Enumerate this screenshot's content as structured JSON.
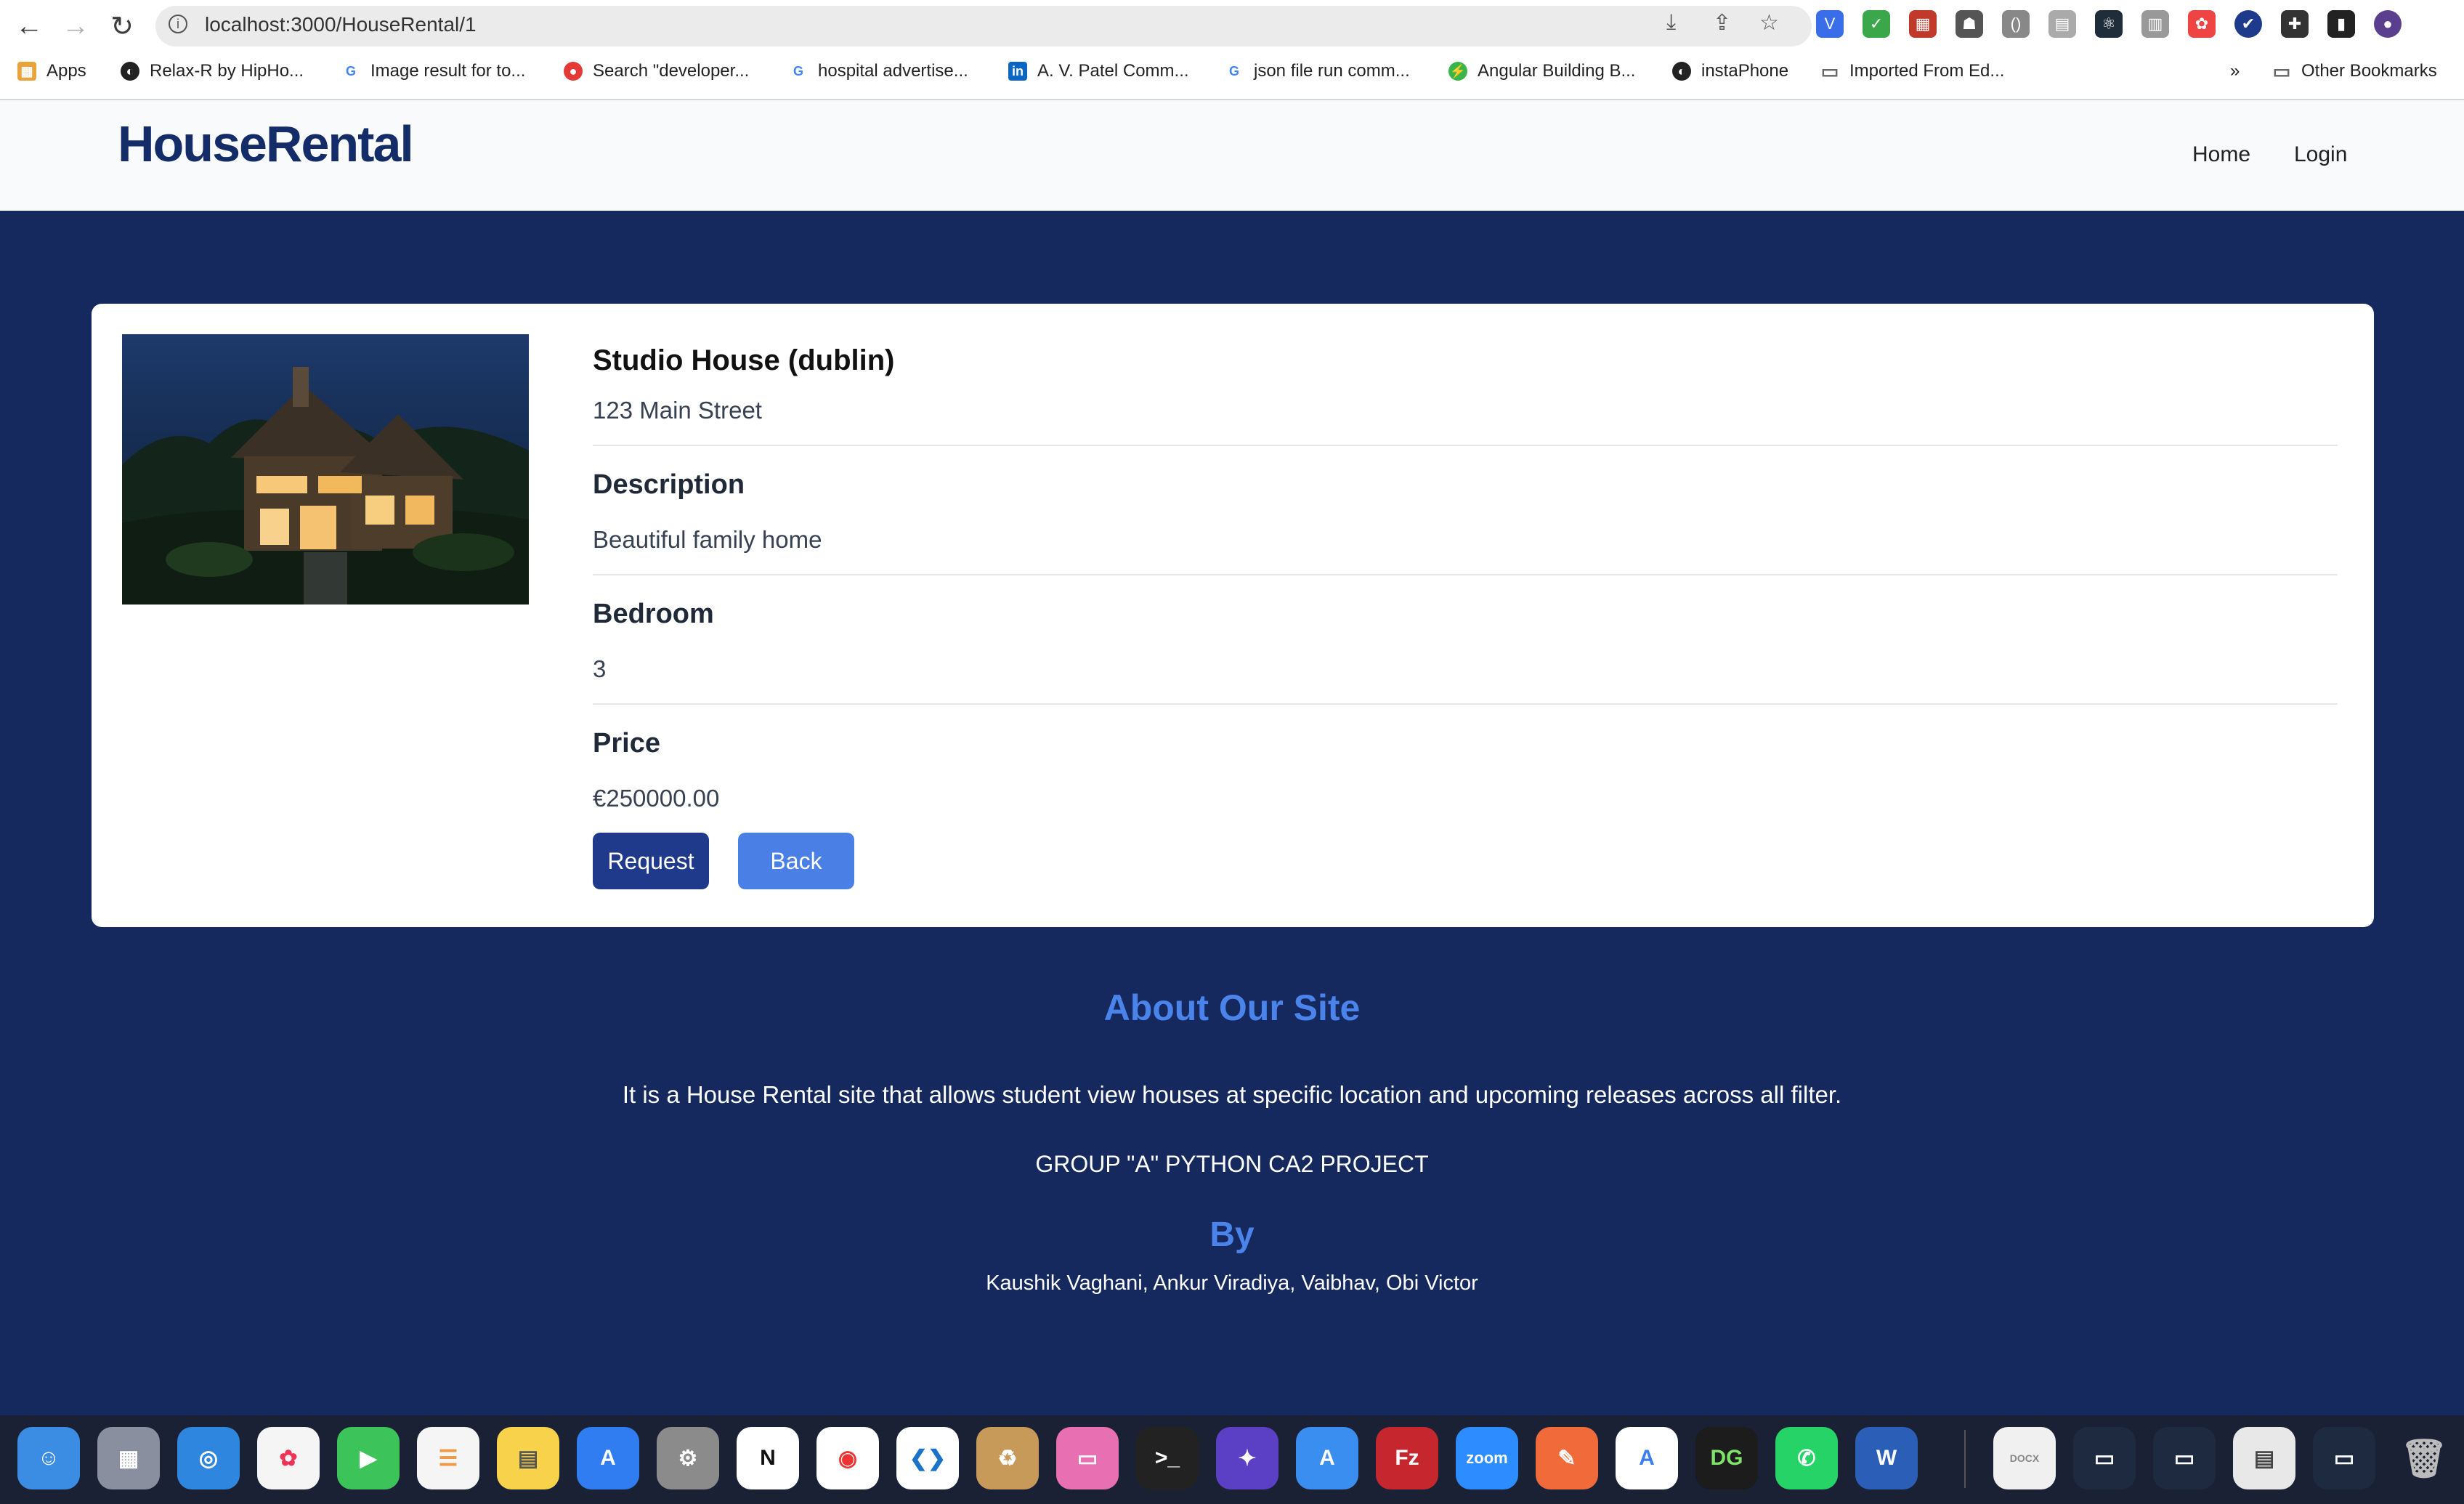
{
  "browser": {
    "url": "localhost:3000/HouseRental/1",
    "nav": {
      "back": "←",
      "forward": "→",
      "reload": "↻"
    },
    "bookmarks": [
      {
        "label": "Apps",
        "icon": "apps-grid-icon"
      },
      {
        "label": "Relax-R  by HipHo...",
        "icon": "globe-icon"
      },
      {
        "label": "Image result for to...",
        "icon": "google-icon"
      },
      {
        "label": "Search \"developer...",
        "icon": "red-circle-icon"
      },
      {
        "label": "hospital advertise...",
        "icon": "google-icon"
      },
      {
        "label": "A. V. Patel Comm...",
        "icon": "linkedin-icon"
      },
      {
        "label": "json file run comm...",
        "icon": "google-icon"
      },
      {
        "label": "Angular Building B...",
        "icon": "green-bolt-icon"
      },
      {
        "label": "instaPhone",
        "icon": "globe-icon"
      },
      {
        "label": "Imported From Ed...",
        "icon": "folder-icon"
      },
      {
        "label": "»",
        "icon": ""
      },
      {
        "label": "Other Bookmarks",
        "icon": "folder-icon"
      }
    ]
  },
  "header": {
    "brand": "HouseRental",
    "nav": [
      {
        "label": "Home"
      },
      {
        "label": "Login"
      }
    ]
  },
  "property": {
    "title": "Studio House (dublin)",
    "address": "123 Main Street",
    "description_label": "Description",
    "description": "Beautiful family home",
    "bedroom_label": "Bedroom",
    "bedroom": "3",
    "price_label": "Price",
    "price": "€250000.00",
    "request_label": "Request",
    "back_label": "Back"
  },
  "about": {
    "heading": "About Our Site",
    "text": "It is a House Rental site that allows student view houses at specific location and upcoming releases across all filter.",
    "project": "GROUP \"A\" PYTHON CA2 PROJECT",
    "by_heading": "By",
    "authors": "Kaushik Vaghani, Ankur Viradiya, Vaibhav, Obi Victor"
  },
  "colors": {
    "page_bg": "#15295e",
    "brand": "#142c67",
    "request_button": "#1f3a8a",
    "back_button": "#4a7fe6",
    "accent_heading": "#4a84ea"
  },
  "dock": [
    "Finder",
    "Launchpad",
    "Safari",
    "Photos",
    "FaceTime",
    "Reminders",
    "Notes",
    "App Store",
    "System Preferences",
    "Notion",
    "Chrome",
    "VS Code",
    "Archive Utility",
    "Screens",
    "Terminal",
    "Siri",
    "Xcode",
    "FileZilla",
    "zoom",
    "Pen",
    "Instruments",
    "DataGrip",
    "WhatsApp",
    "Word",
    "Docs",
    "Win1",
    "Win2",
    "Win3",
    "Win4",
    "Trash"
  ],
  "dock_labels": {
    "zoom": "zoom",
    "filezilla": "Fz",
    "datagrip": "DG",
    "word": "W",
    "notion": "N",
    "docx": "DOCX"
  }
}
